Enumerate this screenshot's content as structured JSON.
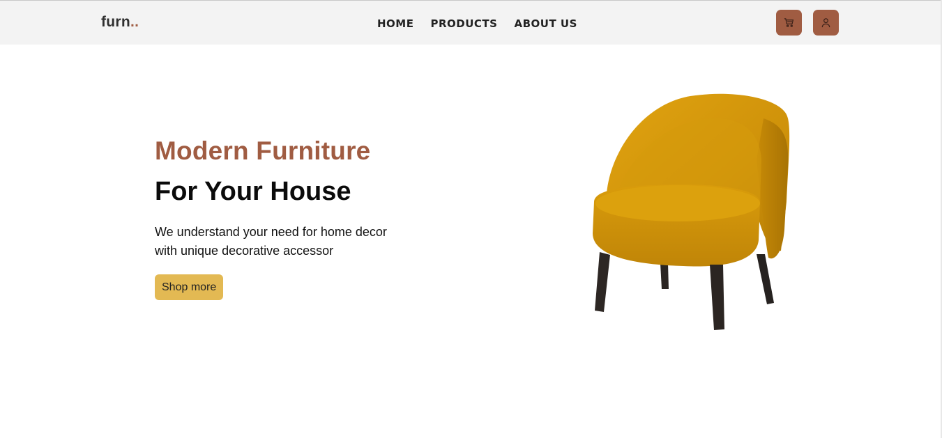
{
  "header": {
    "logo_text": "furn",
    "logo_dots": "..",
    "nav": [
      {
        "label": "HOME"
      },
      {
        "label": "PRODUCTS"
      },
      {
        "label": "ABOUT US"
      }
    ],
    "cart_icon": "cart-icon",
    "user_icon": "user-icon"
  },
  "hero": {
    "title": "Modern Furniture",
    "subtitle": "For Your House",
    "description": "We understand your need for home decor with unique decorative accessor",
    "cta_label": "Shop more",
    "image": "armchair-image"
  },
  "colors": {
    "accent": "#a05c42",
    "button": "#e3b953",
    "navbar_bg": "#f3f3f3",
    "chair": "#d49a0c"
  }
}
